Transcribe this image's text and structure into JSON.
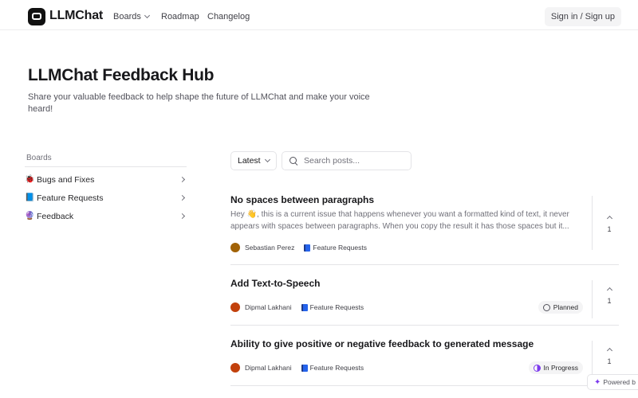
{
  "header": {
    "brand": "LLMChat",
    "nav": {
      "boards": "Boards",
      "roadmap": "Roadmap",
      "changelog": "Changelog"
    },
    "signin": "Sign in / Sign up"
  },
  "hero": {
    "title": "LLMChat Feedback Hub",
    "subtitle": "Share your valuable feedback to help shape the future of LLMChat and make your voice heard!"
  },
  "sidebar": {
    "label": "Boards",
    "items": [
      {
        "emoji": "🐞",
        "label": "Bugs and Fixes"
      },
      {
        "emoji": "📘",
        "label": "Feature Requests"
      },
      {
        "emoji": "🔮",
        "label": "Feedback"
      }
    ]
  },
  "toolbar": {
    "sort": "Latest",
    "search_placeholder": "Search posts..."
  },
  "posts": [
    {
      "title": "No spaces between paragraphs",
      "body": "Hey 👋, this is a current issue that happens whenever you want a formatted kind of text, it never appears with spaces between paragraphs. When you copy the result it has those spaces but it...",
      "author": "Sebastian Perez",
      "board": "Feature Requests",
      "votes": "1",
      "status": ""
    },
    {
      "title": "Add Text-to-Speech",
      "body": "",
      "author": "Dipmal Lakhani",
      "board": "Feature Requests",
      "votes": "1",
      "status": "Planned"
    },
    {
      "title": "Ability to give positive or negative feedback to generated message",
      "body": "",
      "author": "Dipmal Lakhani",
      "board": "Feature Requests",
      "votes": "1",
      "status": "In Progress"
    }
  ],
  "powered_by": "Powered b"
}
